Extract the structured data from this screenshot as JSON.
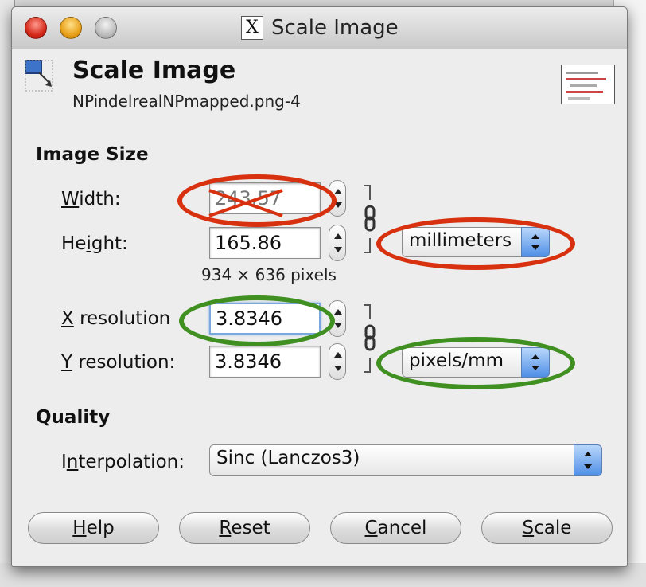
{
  "window": {
    "title": "Scale Image",
    "x_icon": "X"
  },
  "header": {
    "title": "Scale Image",
    "subtitle": "NPindelrealNPmapped.png-4"
  },
  "image_size": {
    "section_label": "Image Size",
    "width_label_pre": "",
    "width_label_u": "W",
    "width_label_post": "idth:",
    "width_value": "243.57",
    "height_label_pre": "He",
    "height_label_u": "i",
    "height_label_post": "ght:",
    "height_value": "165.86",
    "size_unit": "millimeters",
    "pixels_note": "934 × 636 pixels",
    "xres_label_u": "X",
    "xres_label_post": " resolution",
    "xres_value": "3.8346",
    "yres_label_u": "Y",
    "yres_label_post": " resolution:",
    "yres_value": "3.8346",
    "res_unit": "pixels/mm"
  },
  "quality": {
    "section_label": "Quality",
    "interp_label_pre": "I",
    "interp_label_u": "n",
    "interp_label_post": "terpolation:",
    "interp_value": "Sinc (Lanczos3)"
  },
  "buttons": {
    "help_u": "H",
    "help_post": "elp",
    "reset_u": "R",
    "reset_post": "eset",
    "cancel_u": "C",
    "cancel_post": "ancel",
    "scale_u": "S",
    "scale_post": "cale"
  },
  "colors": {
    "red_annotation": "#d7310f",
    "green_annotation": "#3f8f21",
    "select_accent": "#4f8fe6"
  }
}
